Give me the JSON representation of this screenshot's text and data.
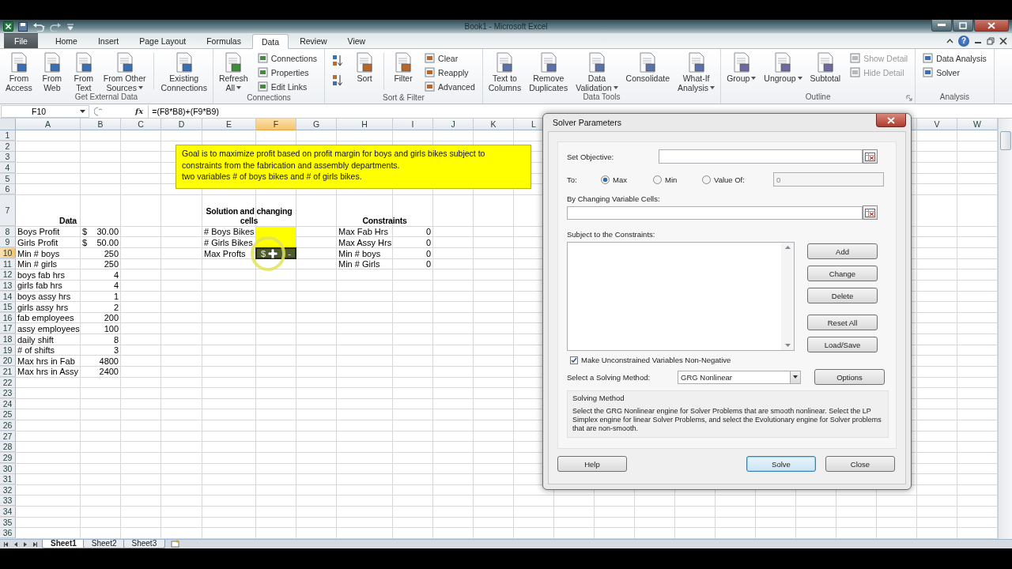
{
  "title_bar": {
    "title": "Book1 - Microsoft Excel",
    "help": "?"
  },
  "tabs": [
    {
      "label": "File",
      "kind": "file",
      "selected": false
    },
    {
      "label": "Home",
      "kind": "tab",
      "selected": false
    },
    {
      "label": "Insert",
      "kind": "tab",
      "selected": false
    },
    {
      "label": "Page Layout",
      "kind": "tab",
      "selected": false
    },
    {
      "label": "Formulas",
      "kind": "tab",
      "selected": false
    },
    {
      "label": "Data",
      "kind": "tab",
      "selected": true
    },
    {
      "label": "Review",
      "kind": "tab",
      "selected": false
    },
    {
      "label": "View",
      "kind": "tab",
      "selected": false
    }
  ],
  "ribbon": [
    {
      "label": "Get External Data",
      "launcher": false,
      "items": [
        {
          "kind": "large",
          "lines": [
            "From",
            "Access"
          ],
          "dropdown": false,
          "disabled": false
        },
        {
          "kind": "large",
          "lines": [
            "From",
            "Web"
          ],
          "dropdown": false,
          "disabled": false
        },
        {
          "kind": "large",
          "lines": [
            "From",
            "Text"
          ],
          "dropdown": false,
          "disabled": false
        },
        {
          "kind": "large",
          "lines": [
            "From Other",
            "Sources"
          ],
          "dropdown": true,
          "disabled": false
        },
        {
          "kind": "separator"
        },
        {
          "kind": "large",
          "lines": [
            "Existing",
            "Connections"
          ],
          "dropdown": false,
          "disabled": false
        }
      ]
    },
    {
      "label": "Connections",
      "launcher": false,
      "items": [
        {
          "kind": "large",
          "lines": [
            "Refresh",
            "All"
          ],
          "dropdown": true,
          "disabled": false
        },
        {
          "kind": "stack",
          "items": [
            {
              "kind": "small",
              "label": "Connections",
              "dropdown": false,
              "disabled": false
            },
            {
              "kind": "small",
              "label": "Properties",
              "dropdown": false,
              "disabled": false
            },
            {
              "kind": "small",
              "label": "Edit Links",
              "dropdown": false,
              "disabled": false
            }
          ]
        }
      ]
    },
    {
      "label": "Sort & Filter",
      "launcher": false,
      "items": [
        {
          "kind": "stack",
          "items": [
            {
              "kind": "sort_ascending",
              "dropdown": false,
              "disabled": false
            },
            {
              "kind": "sort_descending",
              "dropdown": false,
              "disabled": false
            }
          ]
        },
        {
          "kind": "large",
          "lines": [
            "Sort"
          ],
          "dropdown": false,
          "disabled": false
        },
        {
          "kind": "separator"
        },
        {
          "kind": "large",
          "lines": [
            "Filter"
          ],
          "dropdown": false,
          "disabled": false
        },
        {
          "kind": "stack",
          "items": [
            {
              "kind": "small",
              "label": "Clear",
              "dropdown": false,
              "disabled": false
            },
            {
              "kind": "small",
              "label": "Reapply",
              "dropdown": false,
              "disabled": false
            },
            {
              "kind": "small",
              "label": "Advanced",
              "dropdown": false,
              "disabled": false
            }
          ]
        }
      ]
    },
    {
      "label": "Data Tools",
      "launcher": false,
      "items": [
        {
          "kind": "large",
          "lines": [
            "Text to",
            "Columns"
          ],
          "dropdown": false,
          "disabled": false
        },
        {
          "kind": "large",
          "lines": [
            "Remove",
            "Duplicates"
          ],
          "dropdown": false,
          "disabled": false
        },
        {
          "kind": "large",
          "lines": [
            "Data",
            "Validation"
          ],
          "dropdown": true,
          "disabled": false
        },
        {
          "kind": "large",
          "lines": [
            "Consolidate"
          ],
          "dropdown": false,
          "disabled": false
        },
        {
          "kind": "large",
          "lines": [
            "What-If",
            "Analysis"
          ],
          "dropdown": true,
          "disabled": false
        }
      ]
    },
    {
      "label": "Outline",
      "launcher": true,
      "items": [
        {
          "kind": "large",
          "lines": [
            "Group"
          ],
          "dropdown": true,
          "disabled": false
        },
        {
          "kind": "large",
          "lines": [
            "Ungroup"
          ],
          "dropdown": true,
          "disabled": false
        },
        {
          "kind": "large",
          "lines": [
            "Subtotal"
          ],
          "dropdown": false,
          "disabled": false
        },
        {
          "kind": "stack",
          "items": [
            {
              "kind": "small",
              "label": "Show Detail",
              "dropdown": false,
              "disabled": true
            },
            {
              "kind": "small",
              "label": "Hide Detail",
              "dropdown": false,
              "disabled": true
            }
          ]
        }
      ]
    },
    {
      "label": "Analysis",
      "launcher": false,
      "items": [
        {
          "kind": "stack",
          "items": [
            {
              "kind": "small",
              "label": "Data Analysis",
              "dropdown": false,
              "disabled": false
            },
            {
              "kind": "small",
              "label": "Solver",
              "dropdown": false,
              "disabled": false
            }
          ]
        }
      ]
    }
  ],
  "sheet": {
    "name_box": "F10",
    "function_label": "fx",
    "formula": "=(F8*B8)+(F9*B9)",
    "columns": [
      {
        "label": "A",
        "selected": false
      },
      {
        "label": "B",
        "selected": false
      },
      {
        "label": "C",
        "selected": false
      },
      {
        "label": "D",
        "selected": false
      },
      {
        "label": "E",
        "selected": false
      },
      {
        "label": "F",
        "selected": true
      },
      {
        "label": "G",
        "selected": false
      },
      {
        "label": "H",
        "selected": false
      },
      {
        "label": "I",
        "selected": false
      },
      {
        "label": "J",
        "selected": false
      },
      {
        "label": "K",
        "selected": false
      },
      {
        "label": "L",
        "selected": false
      }
    ],
    "far_columns": [
      {
        "label": "V",
        "selected": false
      },
      {
        "label": "W",
        "selected": false
      }
    ],
    "rows": [
      {
        "label": "1",
        "selected": false
      },
      {
        "label": "2",
        "selected": false
      },
      {
        "label": "3",
        "selected": false
      },
      {
        "label": "4",
        "selected": false
      },
      {
        "label": "5",
        "selected": false
      },
      {
        "label": "6",
        "selected": false
      },
      {
        "label": "7",
        "selected": false,
        "cells": [
          {
            "kind": "heading",
            "text": "Data"
          },
          {},
          {},
          {
            "kind": "heading",
            "text": "Solution and changing cells"
          },
          {},
          {
            "kind": "heading",
            "text": "Constraints"
          }
        ]
      },
      {
        "label": "8",
        "selected": false,
        "cells": [
          {
            "kind": "label",
            "text": "Boys Profit"
          },
          {
            "kind": "currency",
            "symbol": "$",
            "text": "30.00"
          },
          {},
          {},
          {
            "kind": "label",
            "text": "# Boys Bikes"
          },
          {
            "color": "#ffff00"
          },
          {},
          {
            "kind": "label",
            "text": "Max Fab Hrs"
          },
          {
            "kind": "number",
            "text": "0"
          }
        ]
      },
      {
        "label": "9",
        "selected": false,
        "cells": [
          {
            "kind": "label",
            "text": "Girls Profit"
          },
          {
            "kind": "currency",
            "symbol": "$",
            "text": "50.00"
          },
          {},
          {},
          {
            "kind": "label",
            "text": "# Girls Bikes"
          },
          {
            "color": "#ffff00"
          },
          {},
          {
            "kind": "label",
            "text": "Max Assy Hrs"
          },
          {
            "kind": "number",
            "text": "0"
          }
        ]
      },
      {
        "label": "10",
        "selected": true,
        "cells": [
          {
            "kind": "label",
            "text": "Min # boys"
          },
          {
            "kind": "number",
            "text": "250"
          },
          {},
          {},
          {
            "kind": "label",
            "text": "Max Profts"
          },
          {
            "kind": "currency",
            "symbol": "$",
            "text": "-"
          },
          {},
          {
            "kind": "label",
            "text": "Min # boys"
          },
          {
            "kind": "number",
            "text": "0"
          }
        ]
      },
      {
        "label": "11",
        "selected": false,
        "cells": [
          {
            "kind": "label",
            "text": "Min # girls"
          },
          {
            "kind": "number",
            "text": "250"
          },
          {},
          {},
          {},
          {},
          {},
          {
            "kind": "label",
            "text": "Min # Girls"
          },
          {
            "kind": "number",
            "text": "0"
          }
        ]
      },
      {
        "label": "12",
        "selected": false,
        "cells": [
          {
            "kind": "label",
            "text": "boys fab hrs"
          },
          {
            "kind": "number",
            "text": "4"
          }
        ]
      },
      {
        "label": "13",
        "selected": false,
        "cells": [
          {
            "kind": "label",
            "text": "girls fab hrs"
          },
          {
            "kind": "number",
            "text": "4"
          }
        ]
      },
      {
        "label": "14",
        "selected": false,
        "cells": [
          {
            "kind": "label",
            "text": "boys assy hrs"
          },
          {
            "kind": "number",
            "text": "1"
          }
        ]
      },
      {
        "label": "15",
        "selected": false,
        "cells": [
          {
            "kind": "label",
            "text": "girls assy hrs"
          },
          {
            "kind": "number",
            "text": "2"
          }
        ]
      },
      {
        "label": "16",
        "selected": false,
        "cells": [
          {
            "kind": "label",
            "text": "fab employees"
          },
          {
            "kind": "number",
            "text": "200"
          }
        ]
      },
      {
        "label": "17",
        "selected": false,
        "cells": [
          {
            "kind": "label",
            "text": "assy employees"
          },
          {
            "kind": "number",
            "text": "100"
          }
        ]
      },
      {
        "label": "18",
        "selected": false,
        "cells": [
          {
            "kind": "label",
            "text": "daily shift"
          },
          {
            "kind": "number",
            "text": "8"
          }
        ]
      },
      {
        "label": "19",
        "selected": false,
        "cells": [
          {
            "kind": "label",
            "text": "# of shifts"
          },
          {
            "kind": "number",
            "text": "3"
          }
        ]
      },
      {
        "label": "20",
        "selected": false,
        "cells": [
          {
            "kind": "label",
            "text": "Max hrs in Fab"
          },
          {
            "kind": "number",
            "text": "4800"
          }
        ]
      },
      {
        "label": "21",
        "selected": false,
        "cells": [
          {
            "kind": "label",
            "text": "Max hrs in Assy"
          },
          {
            "kind": "number",
            "text": "2400"
          }
        ]
      },
      {
        "label": "22",
        "selected": false
      },
      {
        "label": "23",
        "selected": false
      },
      {
        "label": "24",
        "selected": false
      },
      {
        "label": "25",
        "selected": false
      },
      {
        "label": "26",
        "selected": false
      },
      {
        "label": "27",
        "selected": false
      },
      {
        "label": "28",
        "selected": false
      },
      {
        "label": "29",
        "selected": false
      },
      {
        "label": "30",
        "selected": false
      },
      {
        "label": "31",
        "selected": false
      },
      {
        "label": "32",
        "selected": false
      },
      {
        "label": "33",
        "selected": false
      },
      {
        "label": "34",
        "selected": false
      },
      {
        "label": "35",
        "selected": false
      },
      {
        "label": "36",
        "selected": false
      }
    ],
    "note": {
      "lines": [
        "Goal is to maximize profit based on profit margin for boys and girls bikes subject to",
        "constraints from the fabrication and assembly departments.",
        "two variables # of boys bikes and # of girls bikes."
      ]
    },
    "sheet_tabs": [
      {
        "label": "Sheet1",
        "selected": true
      },
      {
        "label": "Sheet2",
        "selected": false
      },
      {
        "label": "Sheet3",
        "selected": false
      }
    ]
  },
  "dialog": {
    "title": "Solver Parameters",
    "objective_label": "Set Objective:",
    "to_label": "To:",
    "targets": [
      {
        "label": "Max",
        "selected": true
      },
      {
        "label": "Min",
        "selected": false
      },
      {
        "label": "Value Of:",
        "selected": false
      }
    ],
    "value_of": {
      "value": "0",
      "disabled": true
    },
    "changing_label": "By Changing Variable Cells:",
    "constraints_label": "Subject to the Constraints:",
    "edit_buttons": [
      "Add",
      "Change",
      "Delete"
    ],
    "file_buttons": [
      "Reset All",
      "Load/Save"
    ],
    "non_negative": {
      "label": "Make Unconstrained Variables Non-Negative",
      "checked": true
    },
    "method_label": "Select a Solving Method:",
    "method": "GRG Nonlinear",
    "options_button": "Options",
    "method_box": {
      "title": "Solving Method",
      "text": "Select the GRG Nonlinear engine for Solver Problems that are smooth nonlinear. Select the LP Simplex engine for linear Solver Problems, and select the Evolutionary engine for Solver problems that are non-smooth."
    },
    "buttons": [
      {
        "label": "Help",
        "default": false
      },
      {
        "label": "Solve",
        "default": true
      },
      {
        "label": "Close",
        "default": false
      }
    ]
  }
}
